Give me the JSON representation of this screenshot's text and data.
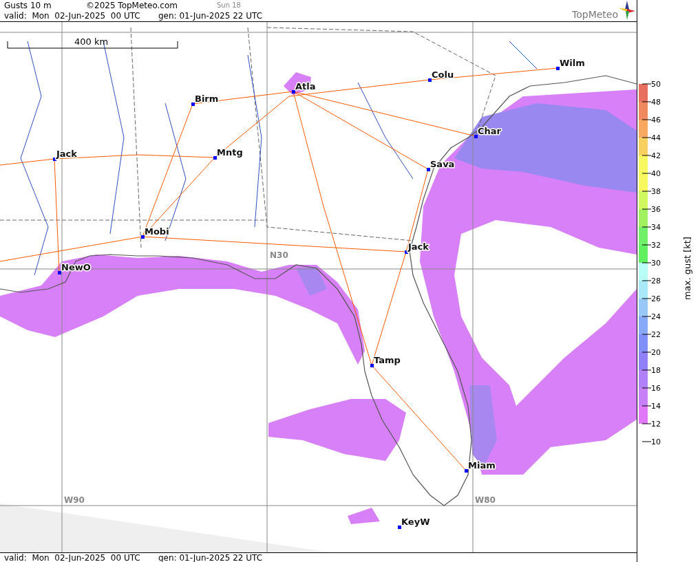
{
  "header": {
    "title": "Gusts 10 m",
    "copyright": "©2025 TopMeteo.com",
    "day_label": "Sun 18",
    "valid": "valid:  Mon  02-Jun-2025  00 UTC",
    "generated": "gen: 01-Jun-2025 22 UTC",
    "logo_text": "TopMeteo"
  },
  "map": {
    "scale_label": "400 km",
    "grid_labels": [
      "N30",
      "W90",
      "W80"
    ],
    "cities": [
      {
        "name": "Wilm"
      },
      {
        "name": "Colu"
      },
      {
        "name": "Atla"
      },
      {
        "name": "Birm"
      },
      {
        "name": "Char"
      },
      {
        "name": "Jack"
      },
      {
        "name": "Mntg"
      },
      {
        "name": "Sava"
      },
      {
        "name": "Mobi"
      },
      {
        "name": "Jack"
      },
      {
        "name": "NewO"
      },
      {
        "name": "Tamp"
      },
      {
        "name": "Miam"
      },
      {
        "name": "KeyW"
      }
    ]
  },
  "legend": {
    "title": "max. gust [kt]",
    "ticks": [
      "50",
      "48",
      "46",
      "44",
      "42",
      "40",
      "38",
      "36",
      "34",
      "32",
      "30",
      "28",
      "26",
      "24",
      "22",
      "20",
      "18",
      "16",
      "14",
      "12",
      "10"
    ],
    "bins": [
      {
        "color": "#e87060"
      },
      {
        "color": "#f08860"
      },
      {
        "color": "#f8a860"
      },
      {
        "color": "#f8d060"
      },
      {
        "color": "#f8f860"
      },
      {
        "color": "#f8f860"
      },
      {
        "color": "#d0f860"
      },
      {
        "color": "#a0f060"
      },
      {
        "color": "#70f068"
      },
      {
        "color": "#60f060"
      },
      {
        "color": "#b8fff8"
      },
      {
        "color": "#a8e8f8"
      },
      {
        "color": "#98c8f8"
      },
      {
        "color": "#88a8f8"
      },
      {
        "color": "#8090f8"
      },
      {
        "color": "#9080f8"
      },
      {
        "color": "#b080f8"
      },
      {
        "color": "#c880f8"
      },
      {
        "color": "#e078f8"
      }
    ]
  },
  "footer": {
    "valid": "valid:  Mon  02-Jun-2025  00 UTC",
    "generated": "gen: 01-Jun-2025 22 UTC"
  }
}
